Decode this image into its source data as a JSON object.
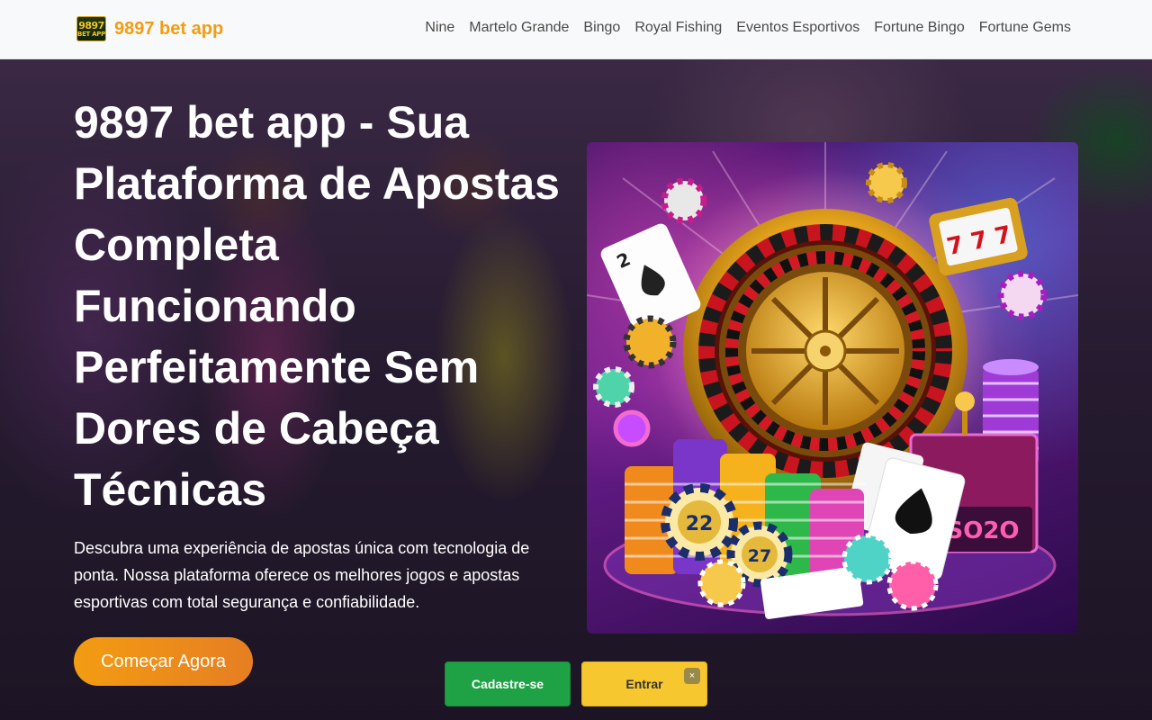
{
  "header": {
    "logo": {
      "line1": "9897",
      "line2": "BET APP"
    },
    "brand_name": "9897 bet app",
    "nav": [
      "Nine",
      "Martelo Grande",
      "Bingo",
      "Royal Fishing",
      "Eventos Esportivos",
      "Fortune Bingo",
      "Fortune Gems"
    ]
  },
  "hero": {
    "title": "9897 bet app - Sua Plataforma de Apostas Completa Funcionando Perfeitamente Sem Dores de Cabeça Técnicas",
    "description": "Descubra uma experiência de apostas única com tecnologia de ponta. Nossa plataforma oferece os melhores jogos e apostas esportivas com total segurança e confiabilidade.",
    "cta_label": "Começar Agora",
    "illustration": {
      "slot_reels": "7 7 7",
      "chip_labels": [
        "22",
        "27"
      ],
      "sign_text": "SO2O",
      "card_rank": "2"
    }
  },
  "floating_bar": {
    "register_label": "Cadastre-se",
    "login_label": "Entrar",
    "close_label": "×"
  },
  "colors": {
    "brand": "#f39c12",
    "register": "#1fa245",
    "login": "#f7c72f"
  }
}
